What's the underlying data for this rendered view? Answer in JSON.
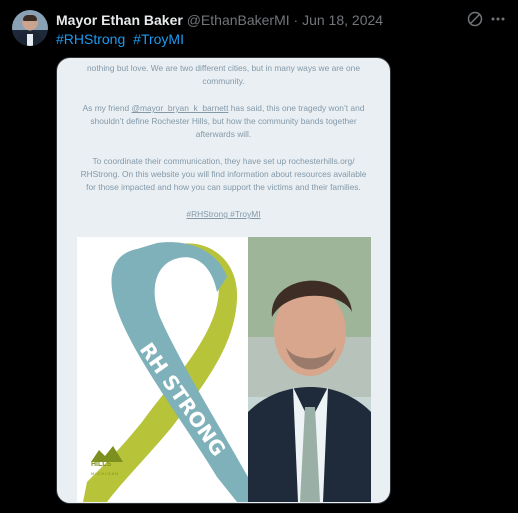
{
  "tweet": {
    "name": "Mayor Ethan Baker",
    "handle": "@EthanBakerMI",
    "separator": "·",
    "date": "Jun 18, 2024",
    "hashtags": [
      "#RHStrong",
      "#TroyMI"
    ]
  },
  "icons": [
    "grok-icon",
    "more-icon"
  ],
  "media": {
    "caption_line1": "nothing but love. We are two different cities, but in many ways we are one community.",
    "caption_p2_a": "As my friend ",
    "caption_mention": "@mayor_bryan_k_barnett",
    "caption_p2_b": " has said, this one tragedy won’t and shouldn’t define Rochester Hills, but how the community bands together afterwards will.",
    "caption_p3": "To coordinate their communication, they have set up rochesterhills.org/ RHStrong. On this website you will find information about resources available for those impacted and how you can support the victims and their families.",
    "caption_tags": "#RHStrong #TroyMI",
    "ribbon_text": "RH STRONG",
    "logo_text": "HILLS",
    "logo_sub": "MICHIGAN"
  },
  "colors": {
    "accent": "#1d9bf0",
    "ribbon_teal": "#7fb1ba",
    "ribbon_green": "#b7c338"
  }
}
